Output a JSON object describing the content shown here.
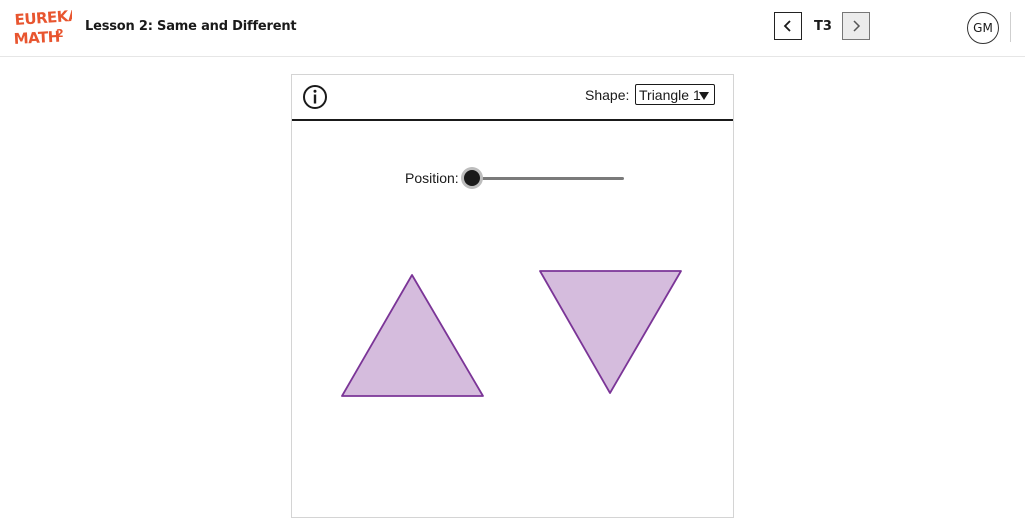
{
  "header": {
    "logo_text_line1": "EUREKA",
    "logo_text_line2": "MATH",
    "logo_sup": "2",
    "lesson_title": "Lesson 2: Same and Different",
    "nav_label": "T3",
    "avatar_initials": "GM"
  },
  "panel": {
    "shape_label": "Shape:",
    "shape_selected": "Triangle 1",
    "position_label": "Position:",
    "position_value": 0
  },
  "colors": {
    "brand": "#e8552f",
    "shape_fill": "#d5bcdd",
    "shape_stroke": "#7b3597"
  }
}
